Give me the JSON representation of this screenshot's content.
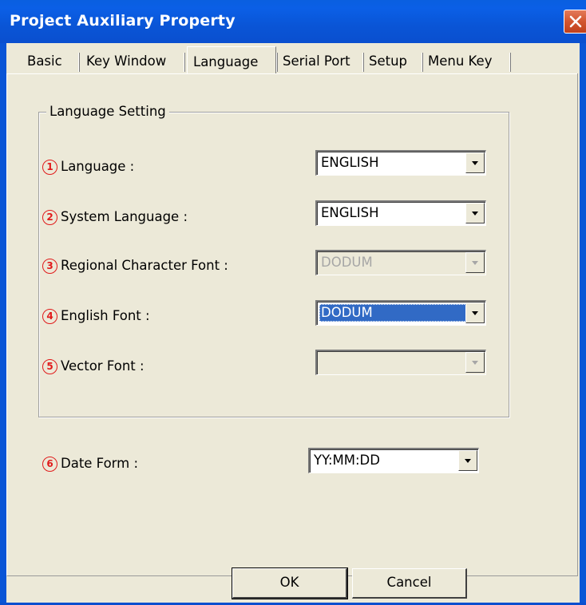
{
  "window": {
    "title": "Project Auxiliary Property"
  },
  "tabs": [
    {
      "label": "Basic"
    },
    {
      "label": "Key Window"
    },
    {
      "label": "Language",
      "active": true
    },
    {
      "label": "Serial Port"
    },
    {
      "label": "Setup"
    },
    {
      "label": "Menu Key"
    }
  ],
  "group": {
    "label": "Language Setting"
  },
  "rows": [
    {
      "badge": "1",
      "label": "Language :",
      "value": "ENGLISH",
      "enabled": true,
      "selected": false
    },
    {
      "badge": "2",
      "label": "System Language :",
      "value": "ENGLISH",
      "enabled": true,
      "selected": false
    },
    {
      "badge": "3",
      "label": "Regional Character Font :",
      "value": "DODUM",
      "enabled": false,
      "selected": false
    },
    {
      "badge": "4",
      "label": "English Font :",
      "value": "DODUM",
      "enabled": true,
      "selected": true
    },
    {
      "badge": "5",
      "label": "Vector Font :",
      "value": "",
      "enabled": false,
      "selected": false
    }
  ],
  "date_form": {
    "badge": "6",
    "label": "Date Form :",
    "value": "YY:MM:DD"
  },
  "buttons": {
    "ok_label": "OK",
    "cancel_label": "Cancel"
  },
  "colors": {
    "title_bar": "#0a55d6",
    "badge": "#e01b1b",
    "selection": "#316ac5",
    "dialog_bg": "#ece9d8"
  }
}
